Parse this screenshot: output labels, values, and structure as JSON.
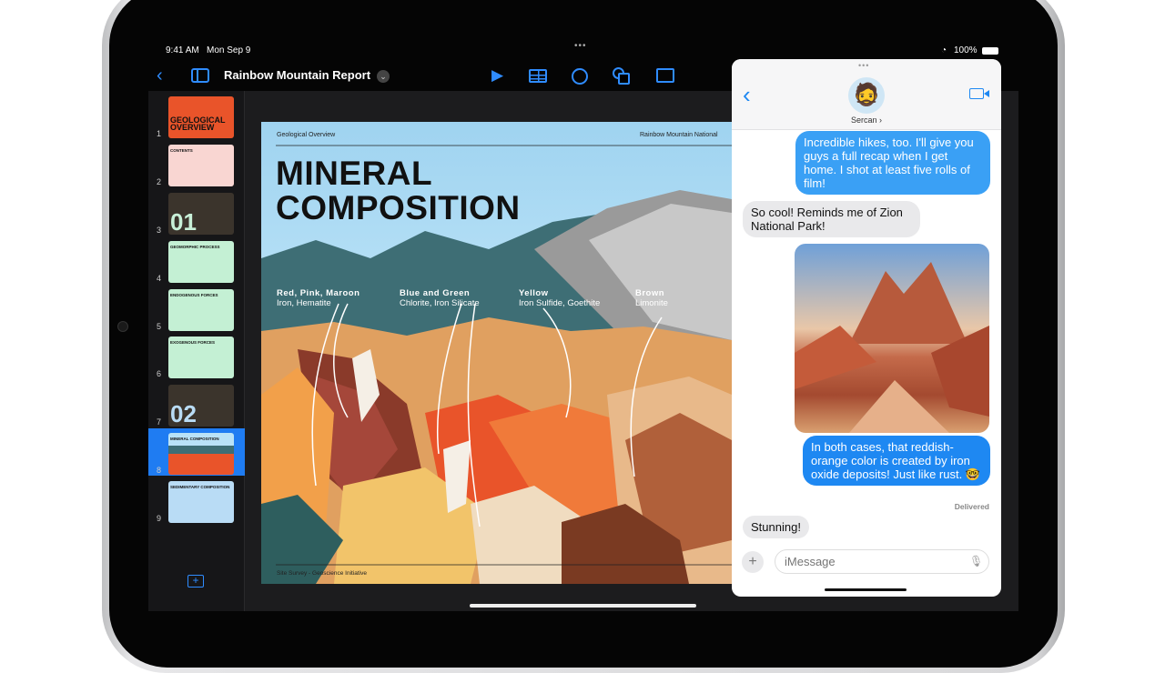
{
  "status": {
    "time": "9:41 AM",
    "date": "Mon Sep 9",
    "battery": "100%"
  },
  "toolbar": {
    "title": "Rainbow Mountain Report",
    "icons": [
      "back-chevron-icon",
      "sidebar-icon",
      "play-icon",
      "table-icon",
      "chart-icon",
      "shapes-icon",
      "media-icon"
    ]
  },
  "slides": [
    {
      "num": "1",
      "label": "GEOLOGICAL OVERVIEW"
    },
    {
      "num": "2",
      "label": "CONTENTS"
    },
    {
      "num": "3",
      "label": "01"
    },
    {
      "num": "4",
      "label": "GEOMORPHIC PROCESS"
    },
    {
      "num": "5",
      "label": "ENDOGENOUS FORCES"
    },
    {
      "num": "6",
      "label": "EXOGENOUS FORCES"
    },
    {
      "num": "7",
      "label": "02"
    },
    {
      "num": "8",
      "label": "MINERAL COMPOSITION"
    },
    {
      "num": "9",
      "label": "SEDIMENTARY COMPOSITION"
    }
  ],
  "selected_slide": "8",
  "slide": {
    "header_left": "Geological Overview",
    "header_right": "Rainbow Mountain National",
    "title_line1": "MINERAL",
    "title_line2": "COMPOSITION",
    "labels": [
      {
        "title": "Red, Pink, Maroon",
        "sub": "Iron, Hematite"
      },
      {
        "title": "Blue and Green",
        "sub": "Chlorite, Iron Silicate"
      },
      {
        "title": "Yellow",
        "sub": "Iron Sulfide, Goethite"
      },
      {
        "title": "Brown",
        "sub": "Limonite"
      }
    ],
    "footer": "Site Survey - Geoscience Initiative"
  },
  "messages": {
    "contact": "Sercan",
    "thread": [
      {
        "from": "me",
        "text": "Incredible hikes, too. I'll give you guys a full recap when I get home. I shot at least five rolls of film!"
      },
      {
        "from": "them",
        "text": "So cool! Reminds me of Zion National Park!"
      },
      {
        "from": "me",
        "type": "image",
        "alt": "red rock canyon photo"
      },
      {
        "from": "me",
        "text": "In both cases, that reddish-orange color is created by iron oxide deposits! Just like rust. 🤓"
      },
      {
        "from": "them",
        "text": "Stunning!"
      }
    ],
    "delivered": "Delivered",
    "input_placeholder": "iMessage",
    "accent": "#1e88f2"
  }
}
